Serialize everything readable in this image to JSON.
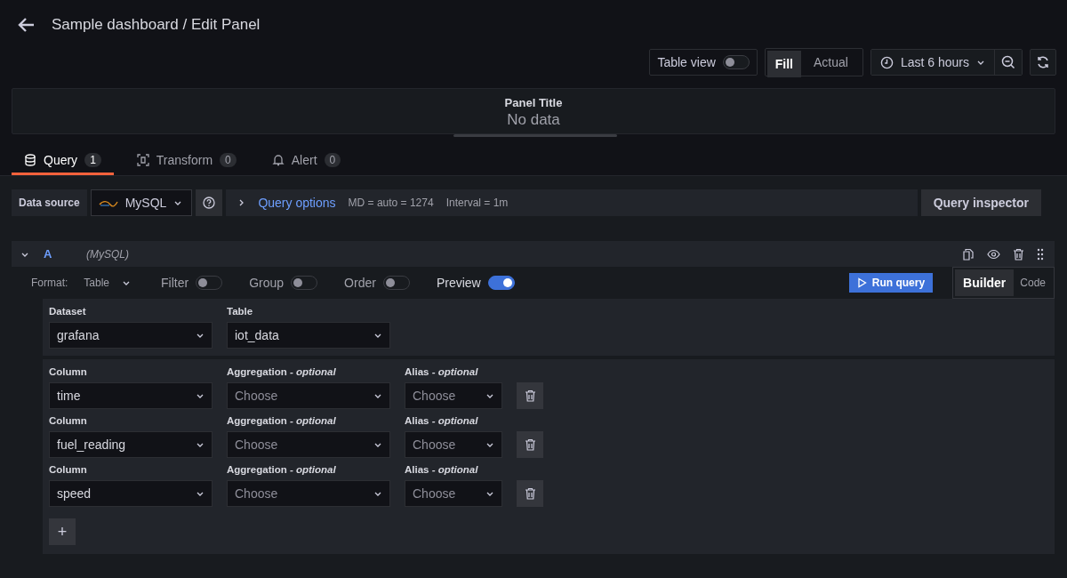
{
  "header": {
    "title": "Sample dashboard / Edit Panel"
  },
  "toolbar": {
    "table_view": {
      "label": "Table view",
      "on": false
    },
    "view_modes": [
      {
        "label": "Fill",
        "selected": true
      },
      {
        "label": "Actual",
        "selected": false
      }
    ],
    "time_range": "Last 6 hours"
  },
  "panel": {
    "title": "Panel Title",
    "message": "No data"
  },
  "tabs": [
    {
      "label": "Query",
      "count": "1",
      "selected": true,
      "kind": "database"
    },
    {
      "label": "Transform",
      "count": "0",
      "selected": false,
      "kind": "transform"
    },
    {
      "label": "Alert",
      "count": "0",
      "selected": false,
      "kind": "bell"
    }
  ],
  "datasource": {
    "label": "Data source",
    "name": "MySQL",
    "query_options": "Query options",
    "max_data_points": "MD = auto = 1274",
    "interval": "Interval = 1m",
    "inspector": "Query inspector"
  },
  "query": {
    "ref": "A",
    "source": "(MySQL)",
    "expanded": true,
    "format_label": "Format:",
    "format": "Table",
    "toggles": [
      {
        "label": "Filter",
        "on": false
      },
      {
        "label": "Group",
        "on": false
      },
      {
        "label": "Order",
        "on": false
      },
      {
        "label": "Preview",
        "on": true
      }
    ],
    "run_button": "Run query",
    "modes": [
      {
        "label": "Builder",
        "selected": true
      },
      {
        "label": "Code",
        "selected": false
      }
    ],
    "dataset": {
      "label": "Dataset",
      "value": "grafana"
    },
    "table": {
      "label": "Table",
      "value": "iot_data"
    },
    "columns": [
      {
        "column_label": "Column",
        "column": "time",
        "aggregation_label": "Aggregation *- optional*",
        "aggregation_placeholder": "Choose",
        "alias_label": "Alias *- optional*",
        "alias_placeholder": "Choose"
      },
      {
        "column_label": "Column",
        "column": "fuel_reading",
        "aggregation_label": "Aggregation *- optional*",
        "aggregation_placeholder": "Choose",
        "alias_label": "Alias *- optional*",
        "alias_placeholder": "Choose"
      },
      {
        "column_label": "Column",
        "column": "speed",
        "aggregation_label": "Aggregation *- optional*",
        "aggregation_placeholder": "Choose",
        "alias_label": "Alias *- optional*",
        "alias_placeholder": "Choose"
      }
    ],
    "add_button": "+"
  }
}
